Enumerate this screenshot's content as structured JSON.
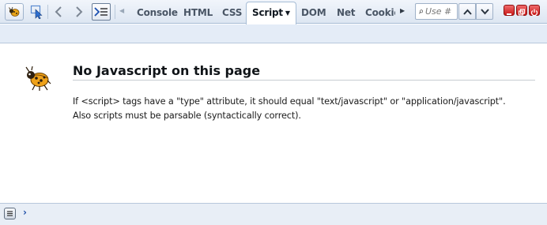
{
  "toolbar": {
    "firebug_icon": "firebug-icon",
    "inspect_icon": "inspect-cursor-icon",
    "back_icon": "chevron-left-icon",
    "forward_icon": "chevron-right-icon",
    "command_icon": "command-line-icon"
  },
  "tabs": [
    {
      "label": "Console",
      "active": false
    },
    {
      "label": "HTML",
      "active": false
    },
    {
      "label": "CSS",
      "active": false
    },
    {
      "label": "Script",
      "active": true
    },
    {
      "label": "DOM",
      "active": false
    },
    {
      "label": "Net",
      "active": false
    },
    {
      "label": "Cookie",
      "active": false
    }
  ],
  "search": {
    "placeholder": "Use #"
  },
  "main": {
    "title": "No Javascript on this page",
    "message_line1": "If <script> tags have a \"type\" attribute, it should equal \"text/javascript\" or \"application/javascript\".",
    "message_line2": "Also scripts must be parsable (syntactically correct)."
  },
  "commandline": {
    "prompt": "›"
  },
  "colors": {
    "toolbar_bg": "#e3eaf4",
    "accent_blue": "#1f4fa8",
    "window_button_red": "#d42020"
  }
}
